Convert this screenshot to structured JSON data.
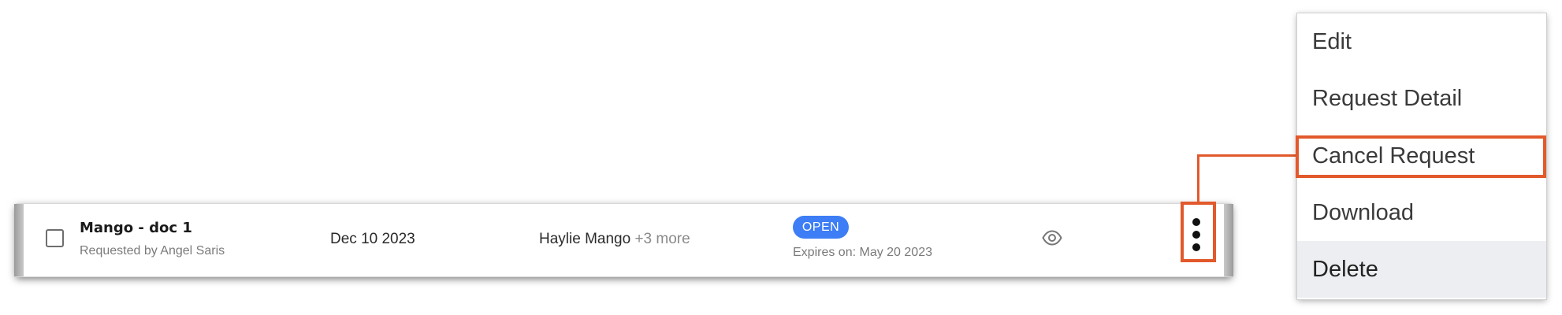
{
  "row": {
    "doc_title": "Mango - doc 1",
    "requested_by": "Requested by Angel Saris",
    "date": "Dec 10 2023",
    "recipient_primary": "Haylie Mango",
    "recipient_more": "+3 more",
    "status_badge": "OPEN",
    "expires": "Expires on: May 20 2023",
    "view_icon": "eye-icon",
    "actions_icon": "kebab-vertical-icon"
  },
  "menu": {
    "items": [
      {
        "label": "Edit"
      },
      {
        "label": "Request Detail"
      },
      {
        "label": "Cancel Request",
        "highlighted": true
      },
      {
        "label": "Download"
      },
      {
        "label": "Delete",
        "hovered": true
      }
    ]
  },
  "colors": {
    "badge": "#3d7df5",
    "highlight": "#e2592c",
    "hover": "#eceef1"
  }
}
